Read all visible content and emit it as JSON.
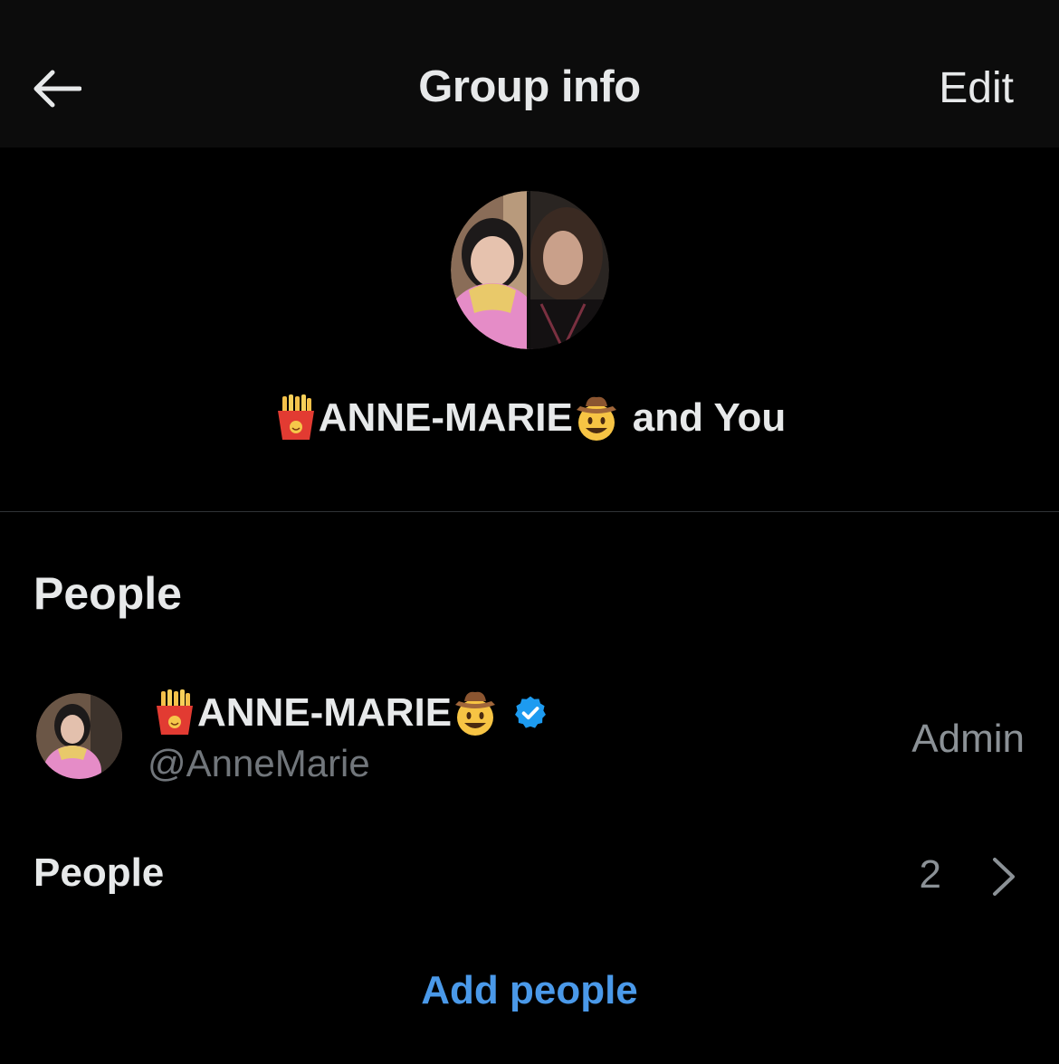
{
  "header": {
    "back_icon": "arrow-left-icon",
    "title": "Group info",
    "edit_label": "Edit"
  },
  "group": {
    "name": "ANNE-MARIE",
    "name_suffix": "and You",
    "prefix_emoji": "french-fries-emoji",
    "suffix_emoji": "cowboy-hat-face-emoji"
  },
  "people_section": {
    "title": "People",
    "members": [
      {
        "name": "ANNE-MARIE",
        "handle": "@AnneMarie",
        "role": "Admin",
        "verified": true
      }
    ]
  },
  "people_row": {
    "label": "People",
    "count": "2"
  },
  "add_people_label": "Add people",
  "colors": {
    "background": "#000000",
    "header_bg": "#0c0c0c",
    "text": "#e7e9ea",
    "secondary_text": "#71767b",
    "accent": "#4a99e9",
    "verified_badge": "#1d9bf0",
    "divider": "#2f3336"
  }
}
